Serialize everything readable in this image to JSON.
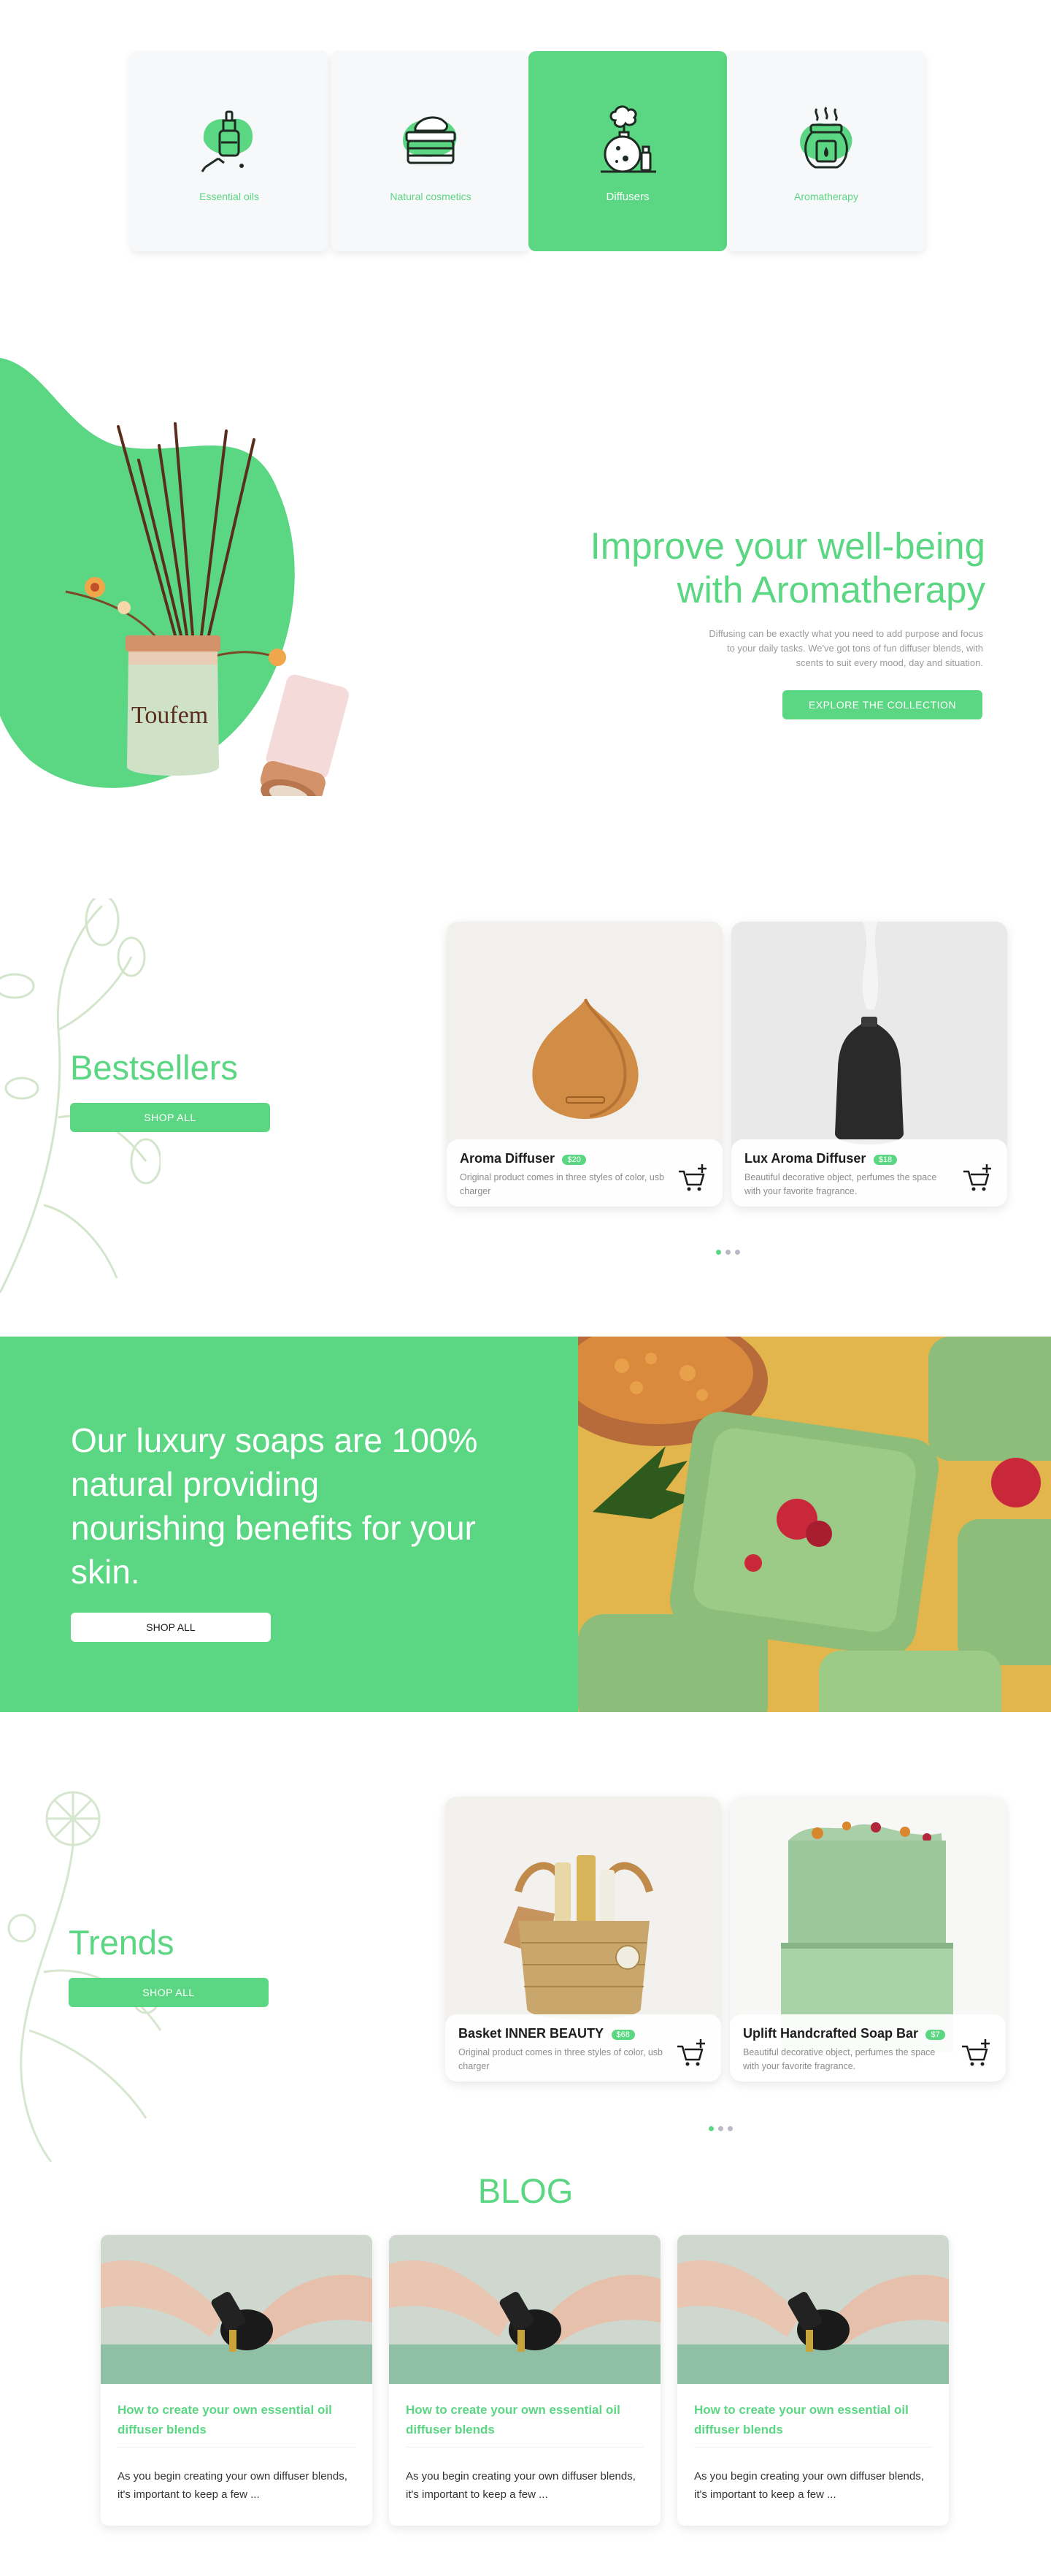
{
  "categories": [
    {
      "label": "Essential oils",
      "icon": "essential-oil-bottle-icon"
    },
    {
      "label": "Natural cosmetics",
      "icon": "cream-jar-icon"
    },
    {
      "label": "Diffusers",
      "icon": "diffuser-icon",
      "active": true
    },
    {
      "label": "Aromatherapy",
      "icon": "aroma-candle-icon"
    }
  ],
  "hero": {
    "title_line1": "Improve your well-being",
    "title_line2": "with Aromatherapy",
    "description": "Diffusing can be exactly what you need to add purpose and focus to your daily tasks. We've got tons of fun diffuser blends, with scents to suit every mood, day and situation.",
    "cta": "EXPLORE THE COLLECTION",
    "product_brand_text": "Toufem"
  },
  "bestsellers": {
    "title": "Bestsellers",
    "cta": "SHOP ALL",
    "products": [
      {
        "name": "Aroma Diffuser",
        "price": "$20",
        "description": "Original product comes in three styles of color, usb charger"
      },
      {
        "name": "Lux Aroma Diffuser",
        "price": "$18",
        "description": "Beautiful decorative object, perfumes the space with your favorite fragrance."
      }
    ]
  },
  "soap_banner": {
    "title": "Our luxury soaps are 100% natural providing nourishing benefits for your skin.",
    "cta": "SHOP ALL"
  },
  "trends": {
    "title": "Trends",
    "cta": "SHOP ALL",
    "products": [
      {
        "name": "Basket INNER BEAUTY",
        "price": "$68",
        "description": "Original product comes in three styles of color, usb charger"
      },
      {
        "name": "Uplift Handcrafted Soap Bar",
        "price": "$7",
        "description": "Beautiful decorative object, perfumes the space with your favorite fragrance."
      }
    ]
  },
  "blog": {
    "title": "BLOG",
    "posts": [
      {
        "title": "How to create your own essential oil diffuser blends",
        "excerpt": "As you begin creating your own diffuser blends, it's important to keep a few ..."
      },
      {
        "title": "How to create your own essential oil diffuser blends",
        "excerpt": "As you begin creating your own diffuser blends, it's important to keep a few ..."
      },
      {
        "title": "How to create your own essential oil diffuser blends",
        "excerpt": "As you begin creating your own diffuser blends, it's important to keep a few ..."
      }
    ]
  },
  "colors": {
    "brand_green": "#5bd683",
    "text_dark": "#1d1d1d",
    "text_muted": "#8d8d8d"
  }
}
